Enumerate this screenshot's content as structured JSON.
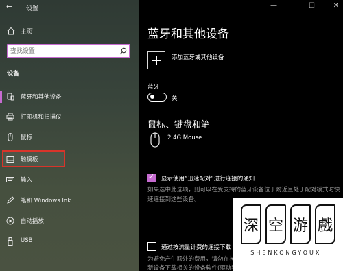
{
  "window": {
    "title": "设置",
    "back_icon": "back-arrow-icon",
    "controls": {
      "minimize": "—",
      "maximize": "☐",
      "close": "✕"
    }
  },
  "sidebar": {
    "home_label": "主页",
    "search_placeholder": "查找设置",
    "section_heading": "设备",
    "items": [
      {
        "label": "蓝牙和其他设备",
        "icon": "bluetooth-icon",
        "active": true
      },
      {
        "label": "打印机和扫描仪",
        "icon": "printer-icon"
      },
      {
        "label": "鼠标",
        "icon": "mouse-icon"
      },
      {
        "label": "触摸板",
        "icon": "touchpad-icon",
        "highlighted": true
      },
      {
        "label": "输入",
        "icon": "keyboard-icon"
      },
      {
        "label": "笔和 Windows Ink",
        "icon": "pen-icon"
      },
      {
        "label": "自动播放",
        "icon": "autoplay-icon"
      },
      {
        "label": "USB",
        "icon": "usb-icon"
      }
    ]
  },
  "main": {
    "title": "蓝牙和其他设备",
    "add_device_label": "添加蓝牙或其他设备",
    "bluetooth_label": "蓝牙",
    "bluetooth_state": "关",
    "section2_title": "鼠标、键盘和笔",
    "device_name": "2.4G Mouse",
    "swift_pair_label": "显示使用“迅速配对”进行连接的通知",
    "swift_pair_checked": true,
    "swift_pair_desc": "如果选中此选项，则可以在受支持的蓝牙设备位于附近且处于配对模式时快速连接到这些设备。",
    "metered_label": "通过按流量计费的连接下载",
    "metered_checked": false,
    "metered_desc": "为避免产生额外的费用，请勿在按流量计费的 Internet 连接时，就不会为新设备下载相关的设备软件(驱动程"
  },
  "watermark": {
    "chars": [
      "深",
      "空",
      "游",
      "戲"
    ],
    "subtitle": "SHENKONGYOUXI"
  },
  "colors": {
    "accent": "#c66bd0",
    "highlight_border": "#d8342a"
  }
}
